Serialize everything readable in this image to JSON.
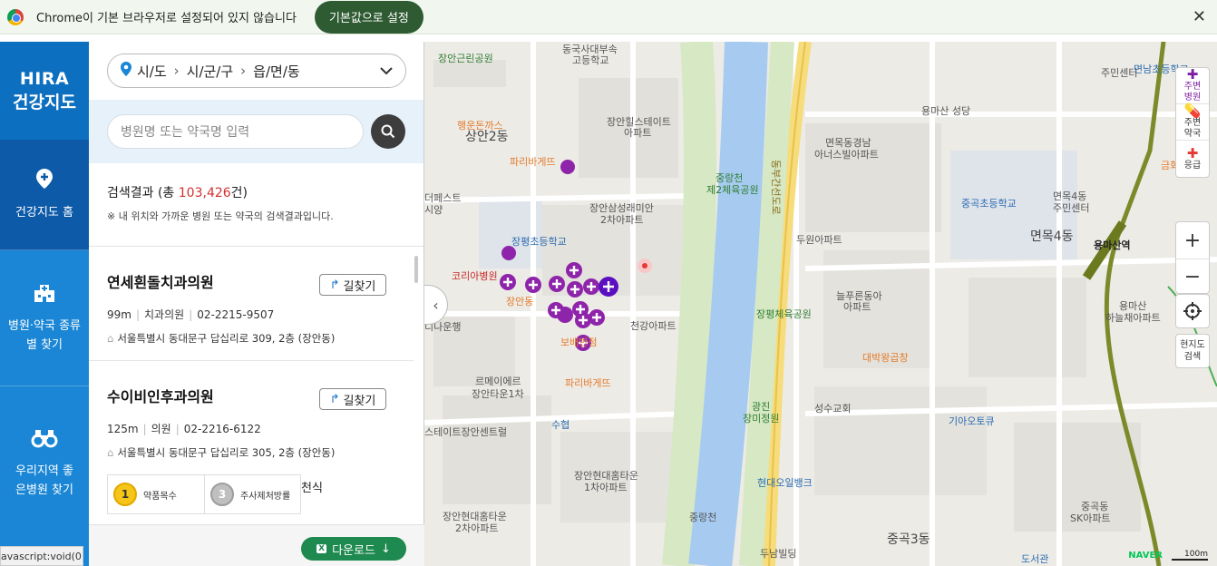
{
  "infobar": {
    "message": "Chrome이 기본 브라우저로 설정되어 있지 않습니다",
    "button": "기본값으로 설정",
    "close": "✕"
  },
  "nav": {
    "logo_line1": "HIRA",
    "logo_line2": "건강지도",
    "items": [
      {
        "label": "건강지도 홈",
        "icon": "map-pin-plus-icon"
      },
      {
        "label": "병원·약국 종류별 찾기",
        "icon": "hospital-building-icon"
      },
      {
        "label": "우리지역 좋은병원 찾기",
        "icon": "binoculars-icon"
      }
    ]
  },
  "region": {
    "sido": "시/도",
    "sigungu": "시/군/구",
    "eupmyeondong": "읍/면/동"
  },
  "search": {
    "placeholder": "병원명 또는 약국명 입력"
  },
  "results": {
    "label_prefix": "검색결과 (총 ",
    "count": "103,426",
    "label_suffix": "건)",
    "note": "※ 내 위치와 가까운 병원 또는 약국의 검색결과입니다."
  },
  "list": [
    {
      "name": "연세흰돌치과의원",
      "directions": "길찾기",
      "distance": "99m",
      "type": "치과의원",
      "phone": "02-2215-9507",
      "address": "서울특별시 동대문구 답십리로 309, 2층 (장안동)"
    },
    {
      "name": "수이비인후과의원",
      "directions": "길찾기",
      "distance": "125m",
      "type": "의원",
      "phone": "02-2216-6122",
      "address": "서울특별시 동대문구 답십리로 305, 2층 (장안동)",
      "badges": [
        {
          "rank": "1",
          "label": "약품목수"
        },
        {
          "rank": "3",
          "label": "주사제처방률"
        }
      ],
      "extra": "천식"
    }
  ],
  "footer": {
    "download": "다운로드",
    "status_url": "avascript:void(0);"
  },
  "map": {
    "labels": [
      "동국사대부속",
      "고등학교",
      "장안근린공원",
      "행운돈까스",
      "상안2동",
      "파리바게뜨",
      "장안힐스테이트",
      "아파트",
      "중랑천",
      "제2체육공원",
      "동부간선도로",
      "면목동경남",
      "아너스빌아파트",
      "중곡초등학교",
      "면목4동",
      "주민센터",
      "장안삼성래미안",
      "2차아파트",
      "장평초등학교",
      "코리아병원",
      "장안동",
      "두원아파트",
      "면목4동",
      "용마산역",
      "늘푸른동아",
      "아파트",
      "장평체육공원",
      "천강아파트",
      "대박왕곱창",
      "용마산",
      "하늘채아파트",
      "보배반점",
      "르메이에르",
      "장안타운1차",
      "파리바게뜨",
      "스테이트장안센트럴",
      "수협",
      "성수교회",
      "광진",
      "장미정원",
      "기아오토큐",
      "장안현대홈타운",
      "1차아파트",
      "현대오일뱅크",
      "장안현대홈타운",
      "2차아파트",
      "중랑천",
      "두남빌딩",
      "중곡3동",
      "중곡동",
      "SK아파트",
      "도서관",
      "용마산 성당",
      "주민센터",
      "면남초등학교",
      "금화",
      "디나운행",
      "더페스트",
      "시양"
    ],
    "controls": [
      {
        "label": "주변 병원",
        "icon": "hospital-plus-icon"
      },
      {
        "label": "주변 약국",
        "icon": "pill-icon"
      },
      {
        "label": "응급",
        "icon": "emergency-icon"
      }
    ],
    "zoom_in": "+",
    "zoom_out": "−",
    "current_search": "현지도 검색",
    "provider": "NAVER",
    "scale": "100m"
  },
  "colors": {
    "brand": "#1a86d5",
    "marker": "#8e24aa",
    "download": "#1e8a4f"
  }
}
